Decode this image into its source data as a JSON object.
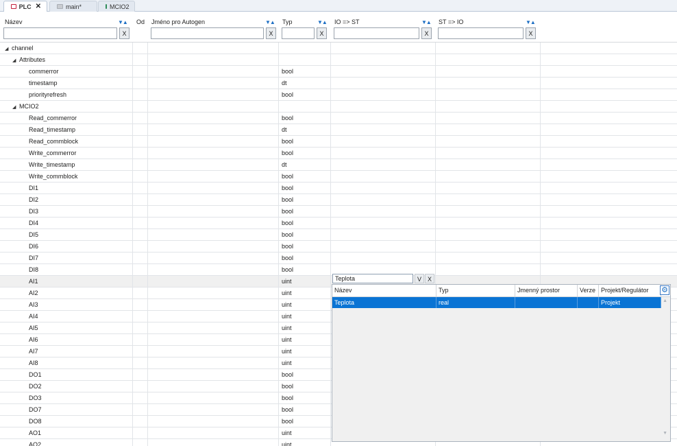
{
  "tabs": [
    {
      "label": "PLC",
      "active": true,
      "close": "✕"
    },
    {
      "label": "main*",
      "active": false
    },
    {
      "label": "MCIO2",
      "active": false
    }
  ],
  "columns": {
    "nazev": "Název",
    "od": "Od",
    "jmeno": "Jméno pro Autogen",
    "typ": "Typ",
    "io_st": "IO => ST",
    "st_io": "ST => IO",
    "sort_glyph": "▼▲",
    "clear_label": "X"
  },
  "tree": [
    {
      "level": 0,
      "expander": "◢",
      "name": "channel",
      "typ": ""
    },
    {
      "level": 1,
      "expander": "◢",
      "name": "Attributes",
      "typ": ""
    },
    {
      "level": 2,
      "name": "commerror",
      "typ": "bool"
    },
    {
      "level": 2,
      "name": "timestamp",
      "typ": "dt"
    },
    {
      "level": 2,
      "name": "priorityrefresh",
      "typ": "bool"
    },
    {
      "level": 1,
      "expander": "◢",
      "name": "MCIO2",
      "typ": ""
    },
    {
      "level": 2,
      "name": "Read_commerror",
      "typ": "bool"
    },
    {
      "level": 2,
      "name": "Read_timestamp",
      "typ": "dt"
    },
    {
      "level": 2,
      "name": "Read_commblock",
      "typ": "bool"
    },
    {
      "level": 2,
      "name": "Write_commerror",
      "typ": "bool"
    },
    {
      "level": 2,
      "name": "Write_timestamp",
      "typ": "dt"
    },
    {
      "level": 2,
      "name": "Write_commblock",
      "typ": "bool"
    },
    {
      "level": 2,
      "name": "DI1",
      "typ": "bool"
    },
    {
      "level": 2,
      "name": "DI2",
      "typ": "bool"
    },
    {
      "level": 2,
      "name": "DI3",
      "typ": "bool"
    },
    {
      "level": 2,
      "name": "DI4",
      "typ": "bool"
    },
    {
      "level": 2,
      "name": "DI5",
      "typ": "bool"
    },
    {
      "level": 2,
      "name": "DI6",
      "typ": "bool"
    },
    {
      "level": 2,
      "name": "DI7",
      "typ": "bool"
    },
    {
      "level": 2,
      "name": "DI8",
      "typ": "bool"
    },
    {
      "level": 2,
      "name": "AI1",
      "typ": "uint",
      "highlight": true
    },
    {
      "level": 2,
      "name": "AI2",
      "typ": "uint"
    },
    {
      "level": 2,
      "name": "AI3",
      "typ": "uint"
    },
    {
      "level": 2,
      "name": "AI4",
      "typ": "uint"
    },
    {
      "level": 2,
      "name": "AI5",
      "typ": "uint"
    },
    {
      "level": 2,
      "name": "AI6",
      "typ": "uint"
    },
    {
      "level": 2,
      "name": "AI7",
      "typ": "uint"
    },
    {
      "level": 2,
      "name": "AI8",
      "typ": "uint"
    },
    {
      "level": 2,
      "name": "DO1",
      "typ": "bool"
    },
    {
      "level": 2,
      "name": "DO2",
      "typ": "bool"
    },
    {
      "level": 2,
      "name": "DO3",
      "typ": "bool"
    },
    {
      "level": 2,
      "name": "DO7",
      "typ": "bool"
    },
    {
      "level": 2,
      "name": "DO8",
      "typ": "bool"
    },
    {
      "level": 2,
      "name": "AO1",
      "typ": "uint"
    },
    {
      "level": 2,
      "name": "AO2",
      "typ": "uint"
    }
  ],
  "lookup": {
    "input_value": "Teplota",
    "btn_v": "V",
    "btn_x": "X",
    "headers": {
      "nazev": "Název",
      "typ": "Typ",
      "prostor": "Jmenný prostor",
      "verze": "Verze",
      "projekt": "Projekt/Regulátor"
    },
    "rows": [
      {
        "nazev": "Teplota",
        "typ": "real",
        "prostor": "",
        "verze": "",
        "projekt": "Projekt",
        "selected": true
      }
    ],
    "gear_icon": "⚙",
    "scroll_up": "▲",
    "scroll_down": "▼"
  },
  "colors": {
    "selection": "#0a74d4",
    "sort_icon": "#1e6fc4",
    "plc_icon": "#c41e3a"
  }
}
